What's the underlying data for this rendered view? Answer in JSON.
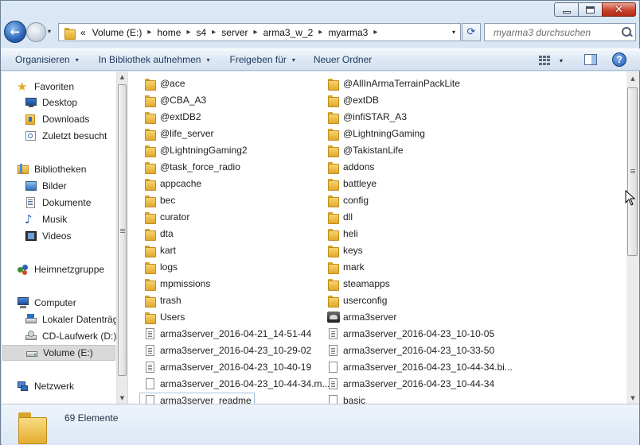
{
  "window": {
    "caption_buttons": {
      "minimize_icon": "minimize-icon",
      "maximize_icon": "restore-icon",
      "close_glyph": "✕"
    }
  },
  "nav": {
    "back_glyph": "←",
    "forward_glyph": "→",
    "recent_glyph": "▾",
    "breadcrumb_overflow": "«",
    "breadcrumbs": [
      "Volume (E:)",
      "home",
      "s4",
      "server",
      "arma3_w_2",
      "myarma3"
    ],
    "separator_glyph": "▸",
    "dropdown_glyph": "▾",
    "refresh_glyph": "⟳",
    "search_placeholder": "myarma3 durchsuchen"
  },
  "toolbar": {
    "organize": "Organisieren",
    "include_in_library": "In Bibliothek aufnehmen",
    "share_with": "Freigeben für",
    "new_folder": "Neuer Ordner",
    "arrow_glyph": "▾",
    "help_glyph": "?"
  },
  "sidebar": {
    "groups": [
      {
        "label": "Favoriten",
        "icon": "star-icon",
        "items": [
          {
            "label": "Desktop",
            "icon": "desktop-icon"
          },
          {
            "label": "Downloads",
            "icon": "downloads-icon"
          },
          {
            "label": "Zuletzt besucht",
            "icon": "recent-places-icon"
          }
        ]
      },
      {
        "label": "Bibliotheken",
        "icon": "libraries-icon",
        "items": [
          {
            "label": "Bilder",
            "icon": "pictures-icon"
          },
          {
            "label": "Dokumente",
            "icon": "documents-icon"
          },
          {
            "label": "Musik",
            "icon": "music-icon"
          },
          {
            "label": "Videos",
            "icon": "videos-icon"
          }
        ]
      },
      {
        "label": "Heimnetzgruppe",
        "icon": "homegroup-icon",
        "items": []
      },
      {
        "label": "Computer",
        "icon": "computer-icon",
        "items": [
          {
            "label": "Lokaler Datenträger (C:)",
            "icon": "local-disk-icon"
          },
          {
            "label": "CD-Laufwerk (D:)",
            "icon": "cd-drive-icon"
          },
          {
            "label": "Volume (E:)",
            "icon": "drive-icon",
            "selected": true
          }
        ]
      },
      {
        "label": "Netzwerk",
        "icon": "network-icon",
        "items": []
      }
    ]
  },
  "files": {
    "left_column": [
      {
        "name": "@ace",
        "type": "folder"
      },
      {
        "name": "@CBA_A3",
        "type": "folder"
      },
      {
        "name": "@extDB2",
        "type": "folder"
      },
      {
        "name": "@life_server",
        "type": "folder"
      },
      {
        "name": "@LightningGaming2",
        "type": "folder"
      },
      {
        "name": "@task_force_radio",
        "type": "folder"
      },
      {
        "name": "appcache",
        "type": "folder"
      },
      {
        "name": "bec",
        "type": "folder"
      },
      {
        "name": "curator",
        "type": "folder"
      },
      {
        "name": "dta",
        "type": "folder"
      },
      {
        "name": "kart",
        "type": "folder"
      },
      {
        "name": "logs",
        "type": "folder"
      },
      {
        "name": "mpmissions",
        "type": "folder"
      },
      {
        "name": "trash",
        "type": "folder"
      },
      {
        "name": "Users",
        "type": "folder"
      },
      {
        "name": "arma3server_2016-04-21_14-51-44",
        "type": "text"
      },
      {
        "name": "arma3server_2016-04-23_10-29-02",
        "type": "text"
      },
      {
        "name": "arma3server_2016-04-23_10-40-19",
        "type": "text"
      },
      {
        "name": "arma3server_2016-04-23_10-44-34.m...",
        "type": "doc"
      },
      {
        "name": "arma3server_readme",
        "type": "doc",
        "focused": true
      }
    ],
    "right_column": [
      {
        "name": "@AllInArmaTerrainPackLite",
        "type": "folder"
      },
      {
        "name": "@extDB",
        "type": "folder"
      },
      {
        "name": "@infiSTAR_A3",
        "type": "folder"
      },
      {
        "name": "@LightningGaming",
        "type": "folder"
      },
      {
        "name": "@TakistanLife",
        "type": "folder"
      },
      {
        "name": "addons",
        "type": "folder"
      },
      {
        "name": "battleye",
        "type": "folder"
      },
      {
        "name": "config",
        "type": "folder"
      },
      {
        "name": "dll",
        "type": "folder"
      },
      {
        "name": "heli",
        "type": "folder"
      },
      {
        "name": "keys",
        "type": "folder"
      },
      {
        "name": "mark",
        "type": "folder"
      },
      {
        "name": "steamapps",
        "type": "folder"
      },
      {
        "name": "userconfig",
        "type": "folder"
      },
      {
        "name": "arma3server",
        "type": "exe"
      },
      {
        "name": "arma3server_2016-04-23_10-10-05",
        "type": "text"
      },
      {
        "name": "arma3server_2016-04-23_10-33-50",
        "type": "text"
      },
      {
        "name": "arma3server_2016-04-23_10-44-34.bi...",
        "type": "doc"
      },
      {
        "name": "arma3server_2016-04-23_10-44-34",
        "type": "text"
      },
      {
        "name": "basic",
        "type": "doc"
      }
    ]
  },
  "status": {
    "item_count": "69 Elemente"
  },
  "colors": {
    "selection": "#d9d9d9",
    "folder": "#e8b23a",
    "accent_blue": "#2b63b5",
    "close_red": "#c8452d"
  }
}
